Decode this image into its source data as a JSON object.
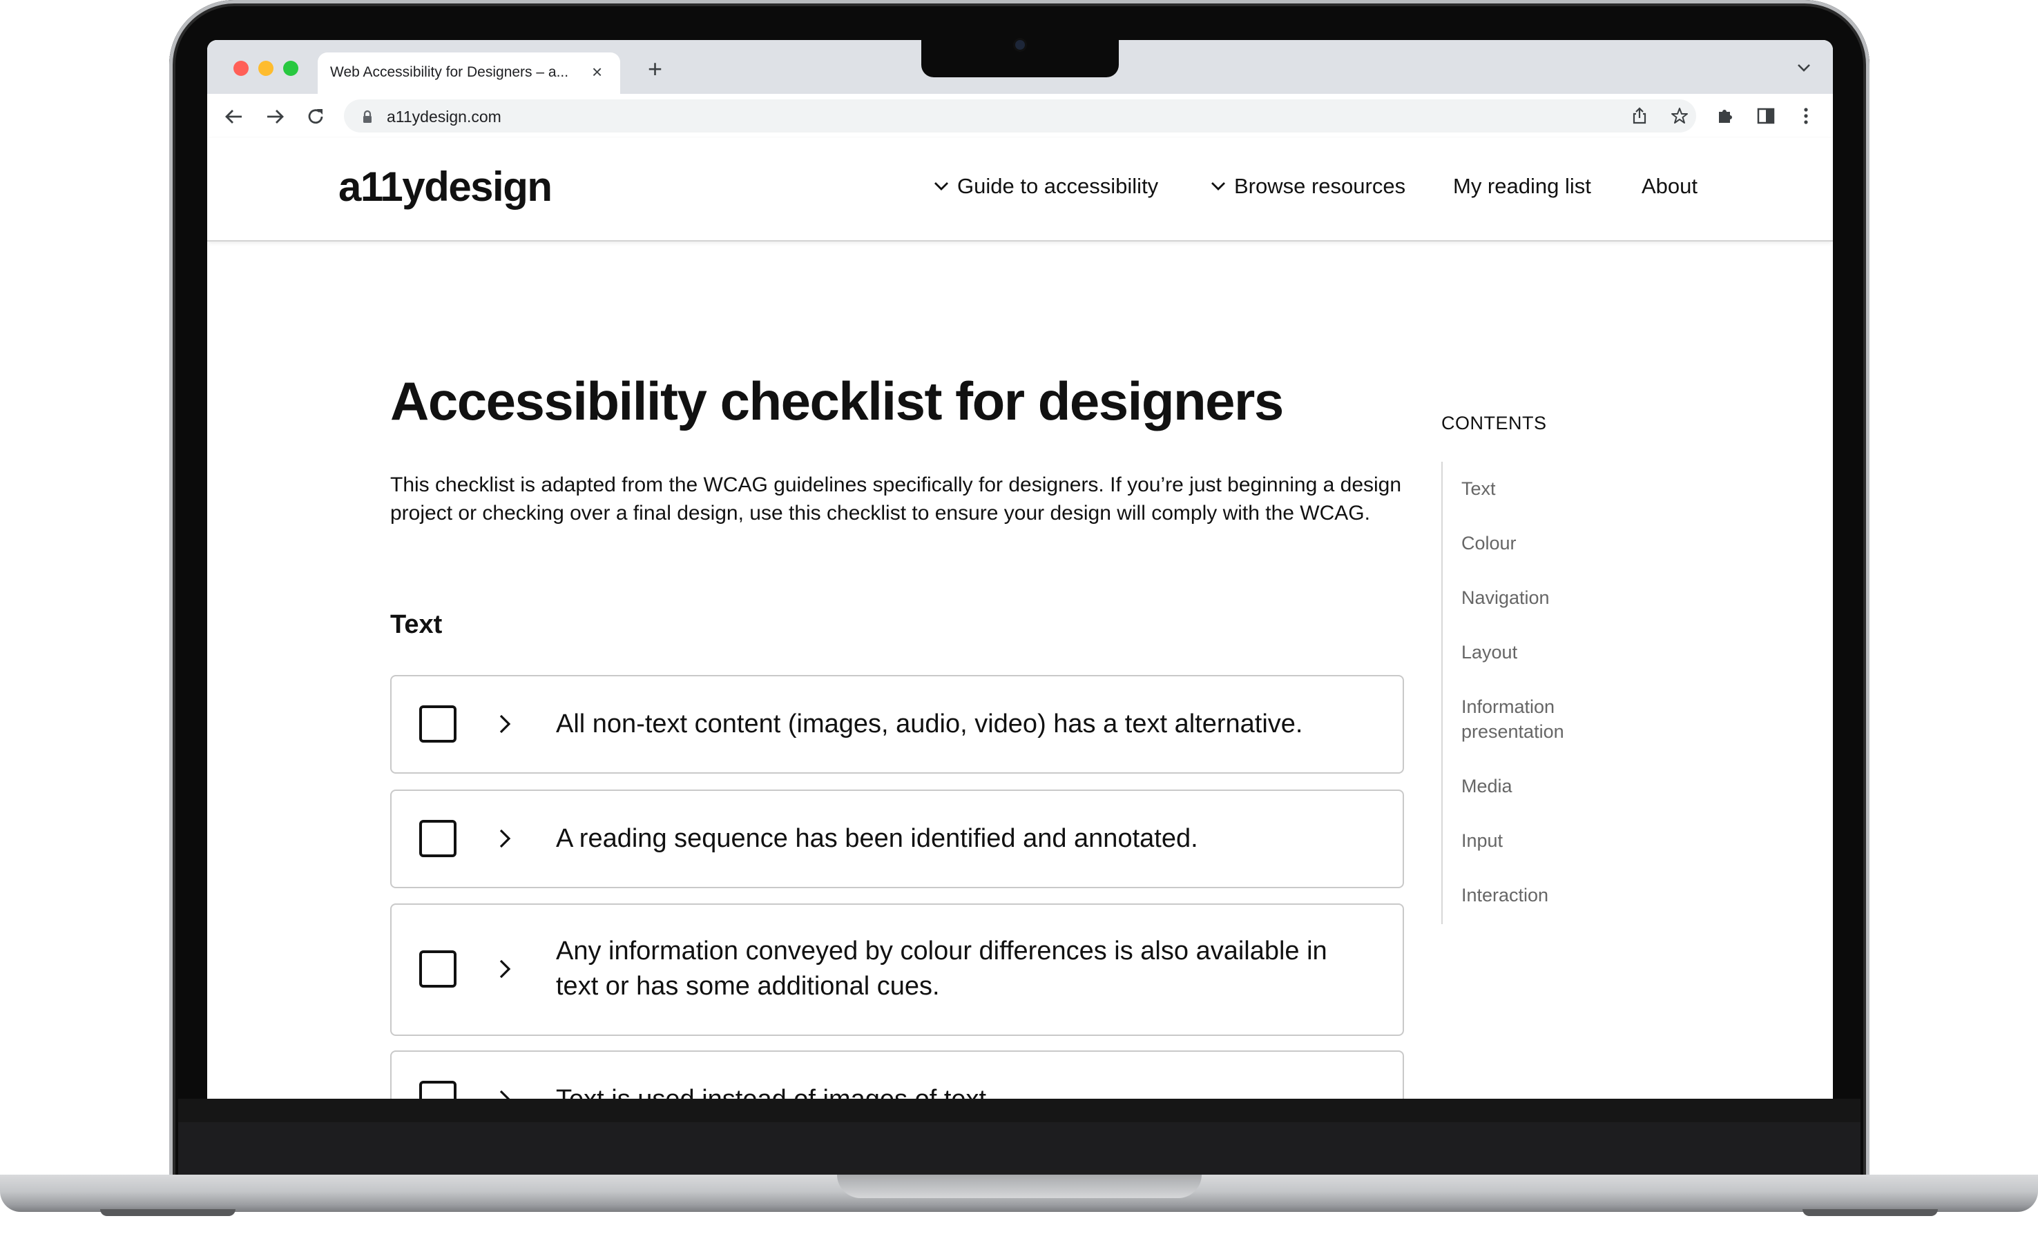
{
  "browser": {
    "tab_title": "Web Accessibility for Designers – a...",
    "tab_close": "×",
    "new_tab": "+",
    "url": "a11ydesign.com",
    "traffic_light_colors": [
      "#ff5f57",
      "#febc2e",
      "#28c840"
    ]
  },
  "site": {
    "logo": "a11ydesign",
    "nav": [
      {
        "label": "Guide to accessibility",
        "dropdown": true
      },
      {
        "label": "Browse resources",
        "dropdown": true
      },
      {
        "label": "My reading list",
        "dropdown": false
      },
      {
        "label": "About",
        "dropdown": false
      }
    ]
  },
  "main": {
    "title": "Accessibility checklist for designers",
    "intro": "This checklist is adapted from the WCAG guidelines specifically for designers. If you’re just beginning a design project or checking over a final design, use this checklist to ensure your design will comply with the WCAG.",
    "section_heading": "Text",
    "checklist": [
      {
        "text": "All non-text content (images, audio, video) has a text alternative.",
        "checked": false
      },
      {
        "text": "A reading sequence has been identified and annotated.",
        "checked": false
      },
      {
        "text": "Any information conveyed by colour differences is also available in text or has some additional cues.",
        "checked": false
      },
      {
        "text": "Text is used instead of images of text.",
        "checked": false
      }
    ]
  },
  "contents": {
    "heading": "CONTENTS",
    "items": [
      "Text",
      "Colour",
      "Navigation",
      "Layout",
      "Information presentation",
      "Media",
      "Input",
      "Interaction"
    ]
  }
}
